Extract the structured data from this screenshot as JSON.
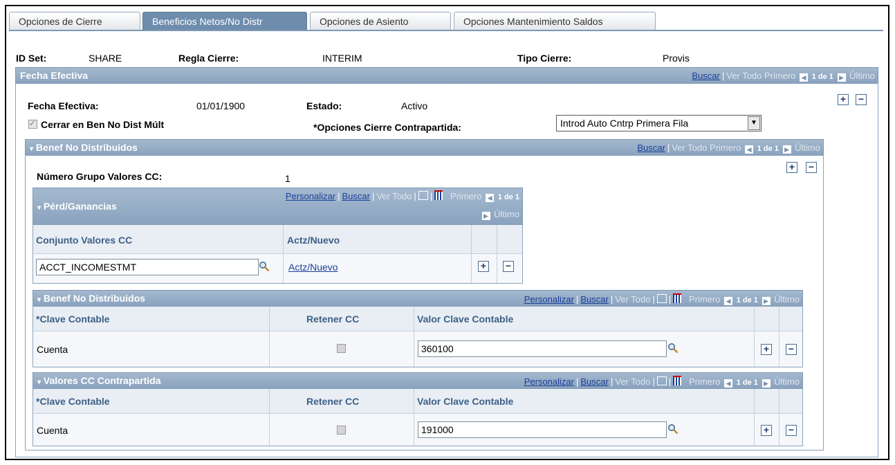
{
  "tabs": [
    {
      "label": "Opciones de Cierre",
      "active": false
    },
    {
      "label": "Beneficios Netos/No Distr",
      "active": true
    },
    {
      "label": "Opciones de Asiento",
      "active": false
    },
    {
      "label": "Opciones Mantenimiento Saldos",
      "active": false
    }
  ],
  "header": {
    "setid_label": "ID Set:",
    "setid_value": "SHARE",
    "rule_label": "Regla Cierre:",
    "rule_value": "INTERIM",
    "type_label": "Tipo Cierre:",
    "type_value": "Provis"
  },
  "nav": {
    "buscar": "Buscar",
    "ver_todo": "Ver Todo",
    "primero": "Primero",
    "count": "1 de 1",
    "ultimo": "Último",
    "personalizar": "Personalizar",
    "sep": "|"
  },
  "fecha_efectiva": {
    "title": "Fecha Efectiva",
    "date_label": "Fecha Efectiva:",
    "date_value": "01/01/1900",
    "status_label": "Estado:",
    "status_value": "Activo",
    "multi_label": "Cerrar en Ben No Dist Múlt",
    "multi_checked": true,
    "offset_label": "*Opciones Cierre Contrapartida:",
    "offset_value": "Introd Auto Cntrp Primera Fila"
  },
  "benef_no_dist": {
    "title": "Benef No Distribuidos",
    "group_label": "Número Grupo Valores CC:",
    "group_value": "1"
  },
  "perd_ganancias": {
    "title": "Pérd/Ganancias",
    "col_set": "Conjunto Valores CC",
    "col_update": "Actz/Nuevo",
    "row_value": "ACCT_INCOMESTMT",
    "row_link": "Actz/Nuevo"
  },
  "grid_benef": {
    "title": "Benef No Distribuidos",
    "col_key": "*Clave Contable",
    "col_retain": "Retener CC",
    "col_value": "Valor Clave Contable",
    "row_key": "Cuenta",
    "row_value": "360100"
  },
  "grid_offset": {
    "title": "Valores CC Contrapartida",
    "col_key": "*Clave Contable",
    "col_retain": "Retener CC",
    "col_value": "Valor Clave Contable",
    "row_key": "Cuenta",
    "row_value": "191000"
  },
  "glyphs": {
    "plus": "+",
    "minus": "−",
    "left": "◀",
    "right": "▶",
    "down": "▼",
    "check": "✓",
    "collapse": "▾"
  }
}
